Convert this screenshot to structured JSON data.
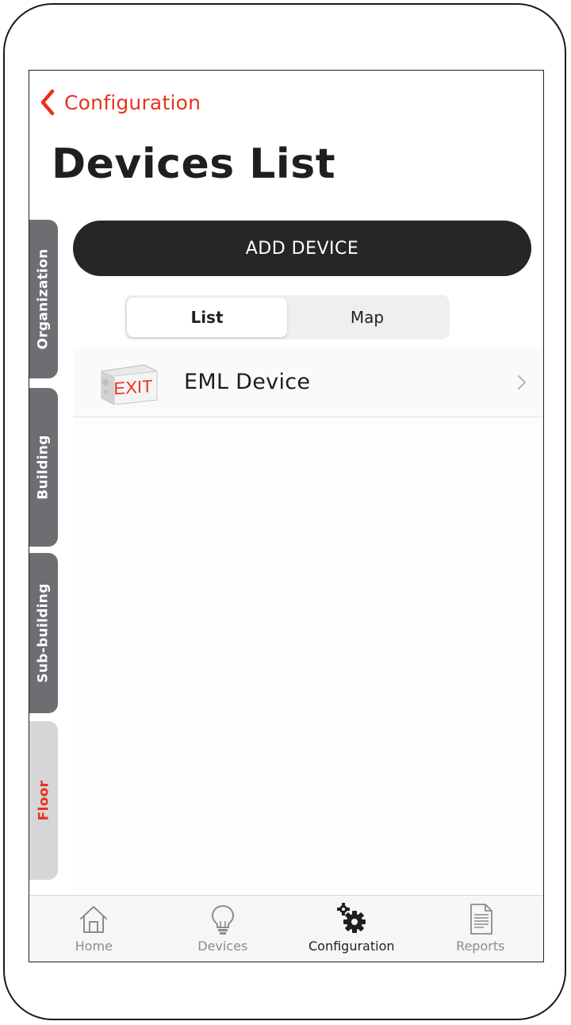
{
  "header": {
    "back_label": "Configuration",
    "title": "Devices List"
  },
  "side_tabs": [
    {
      "label": "Organization",
      "state": "inactive"
    },
    {
      "label": "Building",
      "state": "inactive"
    },
    {
      "label": "Sub-building",
      "state": "inactive"
    },
    {
      "label": "Floor",
      "state": "active"
    }
  ],
  "add_device_label": "ADD DEVICE",
  "view_toggle": {
    "options": [
      "List",
      "Map"
    ],
    "selected": "List"
  },
  "devices": [
    {
      "name": "EML Device",
      "thumbnail_icon": "exit-sign-icon",
      "thumbnail_text": "EXIT"
    }
  ],
  "tab_bar": [
    {
      "label": "Home",
      "icon": "home-icon"
    },
    {
      "label": "Devices",
      "icon": "lightbulb-icon"
    },
    {
      "label": "Configuration",
      "icon": "gears-icon"
    },
    {
      "label": "Reports",
      "icon": "document-icon"
    }
  ],
  "tab_bar_active": "Configuration",
  "colors": {
    "accent": "#e8321e",
    "button_dark": "#262626",
    "side_tab_dark": "#6d6e71",
    "side_tab_light": "#d5d6d8"
  }
}
